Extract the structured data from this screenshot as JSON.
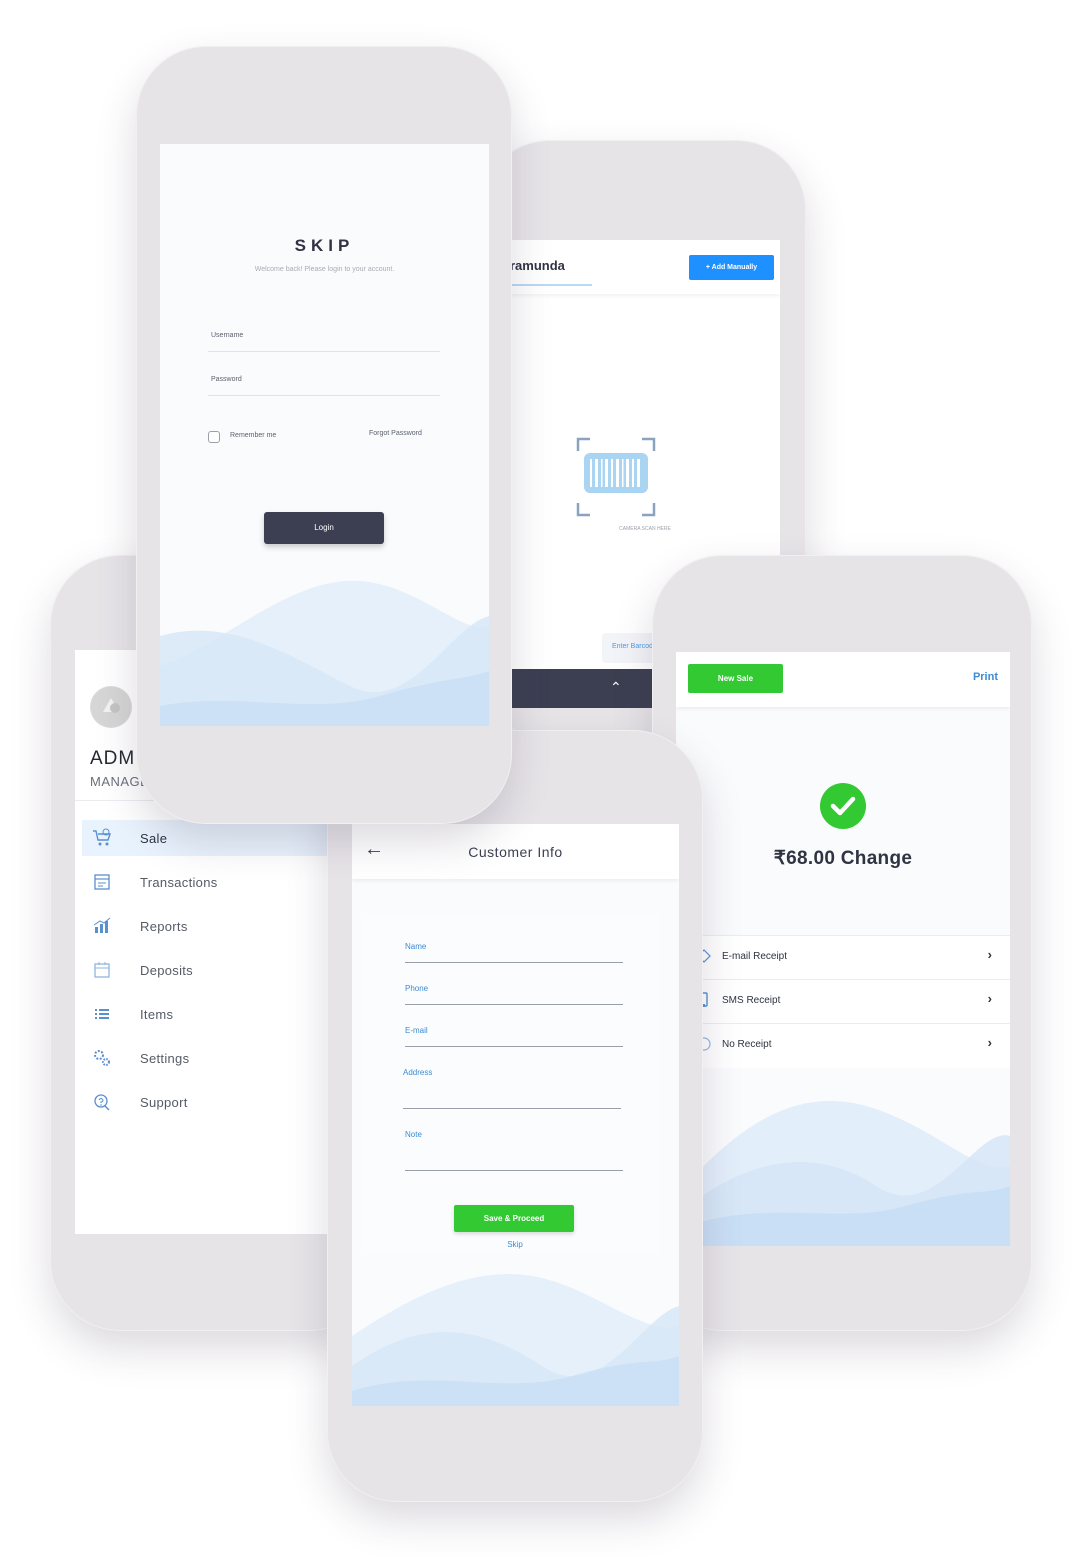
{
  "login": {
    "brand": "SKIP",
    "tagline": "Welcome back! Please login to your account.",
    "username_label": "Username",
    "password_label": "Password",
    "remember_label": "Remember me",
    "forgot_label": "Forgot Password",
    "login_button": "Login"
  },
  "scan": {
    "name": "ramunda",
    "add_button": "+ Add Manually",
    "camera_text": "CAMERA SCAN HERE",
    "enter_barcode": "Enter Barcode"
  },
  "menu": {
    "user_name": "ADMI",
    "user_role": "MANAGE",
    "items": [
      {
        "label": "Sale",
        "icon": "cart-icon"
      },
      {
        "label": "Transactions",
        "icon": "transactions-icon"
      },
      {
        "label": "Reports",
        "icon": "reports-icon"
      },
      {
        "label": "Deposits",
        "icon": "deposits-icon"
      },
      {
        "label": "Items",
        "icon": "list-icon"
      },
      {
        "label": "Settings",
        "icon": "gears-icon"
      },
      {
        "label": "Support",
        "icon": "support-icon"
      }
    ]
  },
  "customer": {
    "title": "Customer Info",
    "fields": [
      "Name",
      "Phone",
      "E-mail",
      "Address",
      "Note"
    ],
    "save_button": "Save & Proceed",
    "skip_link": "Skip"
  },
  "change": {
    "new_sale": "New Sale",
    "print": "Print",
    "amount": "₹68.00 Change",
    "receipts": [
      {
        "label": "E-mail Receipt",
        "icon": "email-icon"
      },
      {
        "label": "SMS Receipt",
        "icon": "sms-icon"
      },
      {
        "label": "No Receipt",
        "icon": "no-receipt-icon"
      }
    ]
  },
  "colors": {
    "accent_blue": "#1e90ff",
    "success_green": "#33c933",
    "dark_button": "#3c3f52",
    "phone_frame": "#e7e4e8"
  }
}
